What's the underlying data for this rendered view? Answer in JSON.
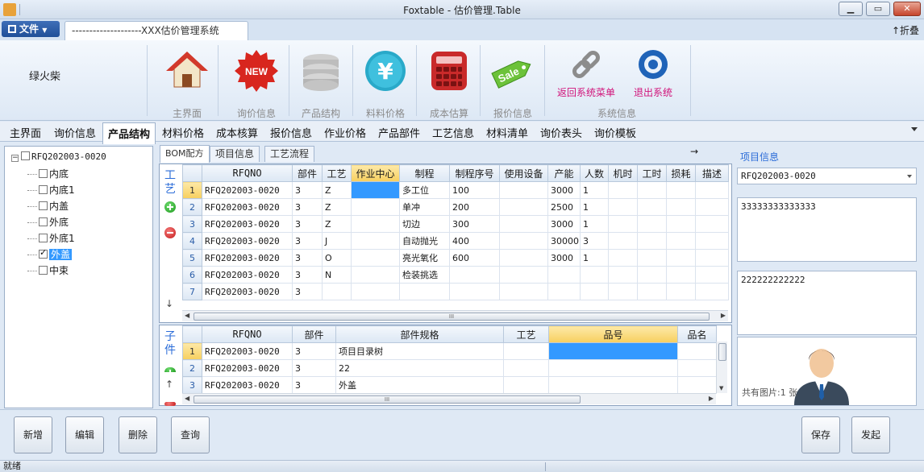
{
  "window": {
    "title": "Foxtable - 估价管理.Table"
  },
  "ribbon_tabs": {
    "file_label": "文件",
    "doc_tab": "--------------------XXX估价管理系统",
    "fold_label": "↑折叠"
  },
  "ribbon": {
    "owner_name": "绿火柴",
    "buttons": [
      {
        "label": "主界面",
        "icon": "house-icon"
      },
      {
        "label": "询价信息",
        "icon": "new-badge-icon"
      },
      {
        "label": "产品结构",
        "icon": "database-icon"
      },
      {
        "label": "料料价格",
        "icon": "yen-icon"
      },
      {
        "label": "成本估算",
        "icon": "calculator-icon"
      },
      {
        "label": "报价信息",
        "icon": "sale-tag-icon"
      }
    ],
    "system_buttons": [
      {
        "label": "返回系统菜单",
        "icon": "chain-link-icon"
      },
      {
        "label": "退出系统",
        "icon": "power-disc-icon"
      }
    ],
    "system_group_label": "系统信息"
  },
  "nav": {
    "items": [
      "主界面",
      "询价信息",
      "产品结构",
      "材料价格",
      "成本核算",
      "报价信息",
      "作业价格",
      "产品部件",
      "工艺信息",
      "材料清单",
      "询价表头",
      "询价模板"
    ],
    "active_index": 2
  },
  "tree": {
    "root": "RFQ202003-0020",
    "children": [
      {
        "label": "内底",
        "checked": false
      },
      {
        "label": "内底1",
        "checked": false
      },
      {
        "label": "内盖",
        "checked": false
      },
      {
        "label": "外底",
        "checked": false
      },
      {
        "label": "外底1",
        "checked": false
      },
      {
        "label": "外盖",
        "checked": true
      },
      {
        "label": "中束",
        "checked": false
      }
    ]
  },
  "subtabs": {
    "items": [
      "BOM配方",
      "项目信息",
      "工艺流程"
    ],
    "arrow": "→"
  },
  "grid1": {
    "side_label": "工艺",
    "columns": [
      "RFQNO",
      "部件",
      "工艺",
      "作业中心",
      "制程",
      "制程序号",
      "使用设备",
      "产能",
      "人数",
      "机时",
      "工时",
      "损耗",
      "描述"
    ],
    "rows": [
      [
        "1",
        "RFQ202003-0020",
        "3",
        "Z",
        "",
        "多工位",
        "100",
        "",
        "3000",
        "1",
        "",
        "",
        "",
        ""
      ],
      [
        "2",
        "RFQ202003-0020",
        "3",
        "Z",
        "",
        "单冲",
        "200",
        "",
        "2500",
        "1",
        "",
        "",
        "",
        ""
      ],
      [
        "3",
        "RFQ202003-0020",
        "3",
        "Z",
        "",
        "切边",
        "300",
        "",
        "3000",
        "1",
        "",
        "",
        "",
        ""
      ],
      [
        "4",
        "RFQ202003-0020",
        "3",
        "J",
        "",
        "自动抛光",
        "400",
        "",
        "30000",
        "3",
        "",
        "",
        "",
        ""
      ],
      [
        "5",
        "RFQ202003-0020",
        "3",
        "O",
        "",
        "亮光氧化",
        "600",
        "",
        "3000",
        "1",
        "",
        "",
        "",
        ""
      ],
      [
        "6",
        "RFQ202003-0020",
        "3",
        "N",
        "",
        "检装挑选",
        "",
        "",
        "",
        "",
        "",
        "",
        "",
        ""
      ],
      [
        "7",
        "RFQ202003-0020",
        "3",
        "",
        "",
        "",
        "",
        "",
        "",
        "",
        "",
        "",
        "",
        ""
      ]
    ]
  },
  "grid2": {
    "side_label": "子件",
    "columns": [
      "RFQNO",
      "部件",
      "部件规格",
      "工艺",
      "品号",
      "品名"
    ],
    "rows": [
      [
        "1",
        "RFQ202003-0020",
        "3",
        "项目目录树",
        "",
        "",
        ""
      ],
      [
        "2",
        "RFQ202003-0020",
        "3",
        "22",
        "",
        "",
        ""
      ],
      [
        "3",
        "RFQ202003-0020",
        "3",
        "外盖",
        "",
        "",
        ""
      ]
    ]
  },
  "right_panel": {
    "title": "项目信息",
    "combo_value": "RFQ202003-0020",
    "text1": "33333333333333",
    "text2": "222222222222",
    "photo_count": "共有图片:1 张"
  },
  "bottom_buttons": {
    "add": "新增",
    "edit": "编辑",
    "delete": "删除",
    "query": "查询",
    "save": "保存",
    "submit": "发起"
  },
  "status": {
    "text": "就绪"
  }
}
